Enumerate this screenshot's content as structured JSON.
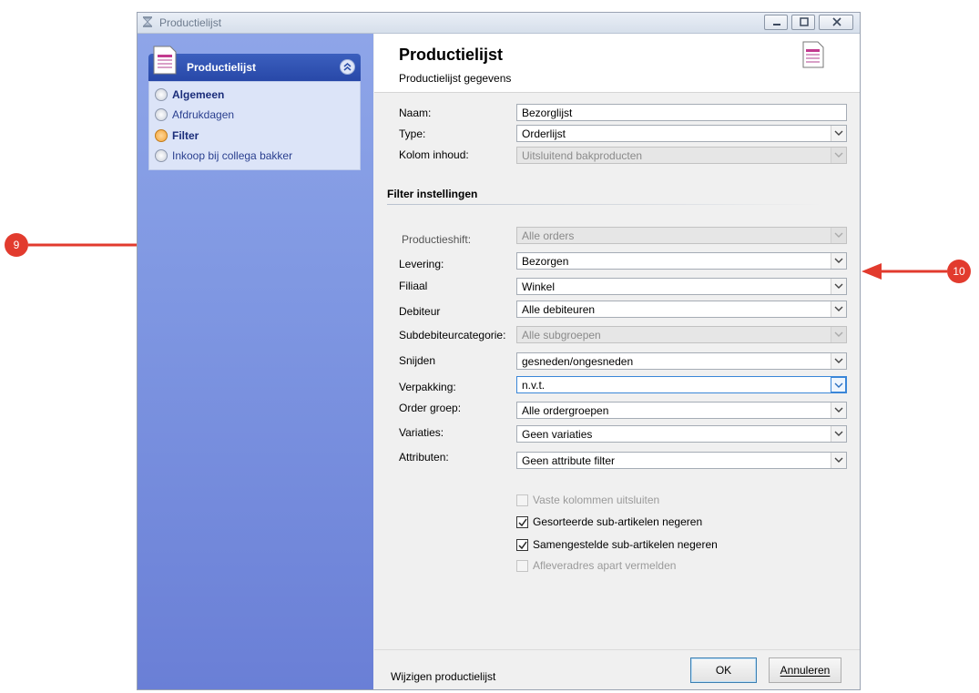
{
  "window": {
    "title": "Productielijst"
  },
  "sidebar": {
    "panel_title": "Productielijst",
    "items": [
      {
        "label": "Algemeen",
        "selected": false,
        "bold": true
      },
      {
        "label": "Afdrukdagen",
        "selected": false,
        "bold": false
      },
      {
        "label": "Filter",
        "selected": true,
        "bold": true
      },
      {
        "label": "Inkoop bij collega bakker",
        "selected": false,
        "bold": false
      }
    ]
  },
  "header": {
    "title": "Productielijst",
    "subtitle": "Productielijst gegevens"
  },
  "general": {
    "naam_label": "Naam:",
    "naam_value": "Bezorglijst",
    "type_label": "Type:",
    "type_value": "Orderlijst",
    "kolom_label": "Kolom inhoud:",
    "kolom_value": "Uitsluitend bakproducten"
  },
  "filter": {
    "section_title": "Filter instellingen",
    "productieshift_label": "Productieshift:",
    "productieshift_value": "Alle orders",
    "levering_label": "Levering:",
    "levering_value": "Bezorgen",
    "filiaal_label": "Filiaal",
    "filiaal_value": "Winkel",
    "debiteur_label": "Debiteur",
    "debiteur_value": "Alle debiteuren",
    "subdebiteur_label": "Subdebiteurcategorie:",
    "subdebiteur_value": "Alle subgroepen",
    "snijden_label": "Snijden",
    "snijden_value": "gesneden/ongesneden",
    "verpakking_label": "Verpakking:",
    "verpakking_value": "n.v.t.",
    "ordergroep_label": "Order groep:",
    "ordergroep_value": "Alle ordergroepen",
    "variaties_label": "Variaties:",
    "variaties_value": "Geen variaties",
    "attributen_label": "Attributen:",
    "attributen_value": "Geen attribute filter"
  },
  "options": {
    "vaste": "Vaste kolommen uitsluiten",
    "gesorteerde": "Gesorteerde sub-artikelen negeren",
    "samengestelde": "Samengestelde sub-artikelen negeren",
    "aflever": "Afleveradres apart vermelden"
  },
  "footer": {
    "status": "Wijzigen productielijst",
    "ok": "OK",
    "cancel": "Annuleren"
  },
  "annotations": {
    "marker_left": "9",
    "marker_right": "10",
    "color": "#e23b2e"
  }
}
